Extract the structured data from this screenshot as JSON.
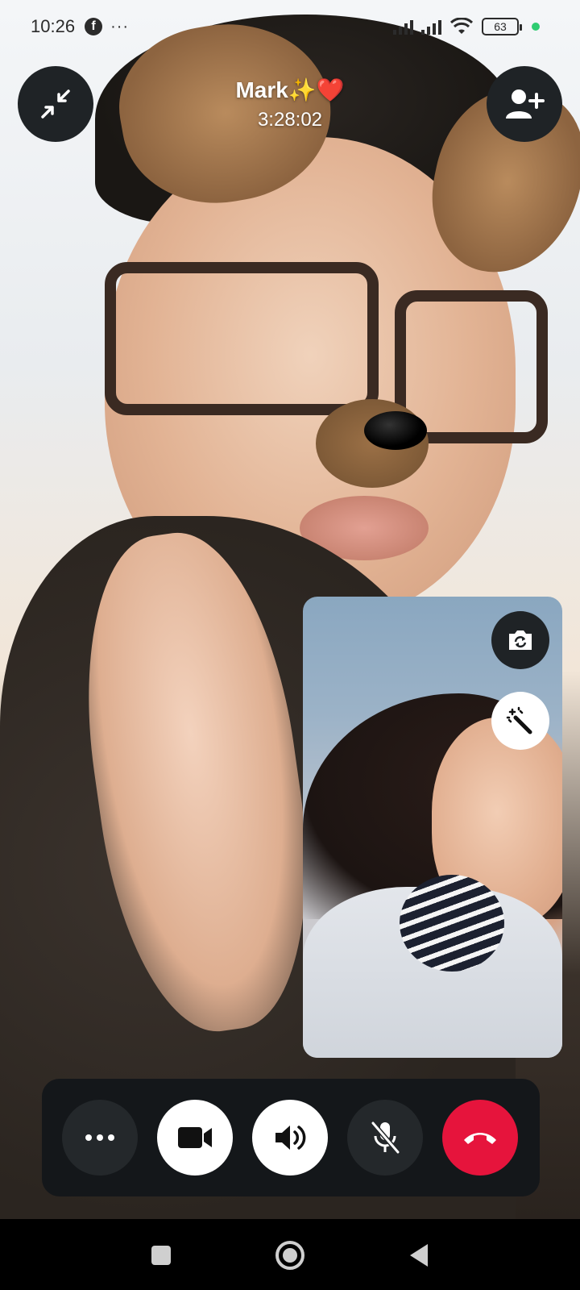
{
  "status_bar": {
    "time": "10:26",
    "facebook_icon": "f",
    "more": "···",
    "battery": "63"
  },
  "call": {
    "contact_name": "Mark✨❤️",
    "duration": "3:28:02"
  },
  "icons": {
    "minimize": "minimize-icon",
    "add_person": "add-person-icon",
    "flip_camera": "flip-camera-icon",
    "effects": "magic-wand-icon",
    "more": "more-dots-icon",
    "video": "video-camera-icon",
    "speaker": "speaker-icon",
    "mic_muted": "mic-off-icon",
    "end_call": "end-call-icon"
  },
  "colors": {
    "end_call": "#e6143c",
    "control_bar": "#14171a",
    "button_dark": "#24282b",
    "button_light": "#ffffff"
  }
}
